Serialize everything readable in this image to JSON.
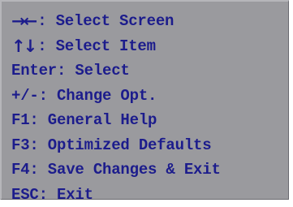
{
  "help_lines": [
    {
      "keys": "→←",
      "text": ": Select Screen"
    },
    {
      "keys": "↑↓",
      "text": ": Select Item"
    },
    {
      "keys": "",
      "text": "Enter: Select"
    },
    {
      "keys": "",
      "text": "+/-: Change Opt."
    },
    {
      "keys": "",
      "text": "F1: General Help"
    },
    {
      "keys": "",
      "text": "F3: Optimized Defaults"
    },
    {
      "keys": "",
      "text": "F4: Save Changes & Exit"
    },
    {
      "keys": "",
      "text": "ESC: Exit"
    }
  ],
  "colors": {
    "panel_background": "#9a9a9e",
    "text": "#1c1c8c"
  }
}
